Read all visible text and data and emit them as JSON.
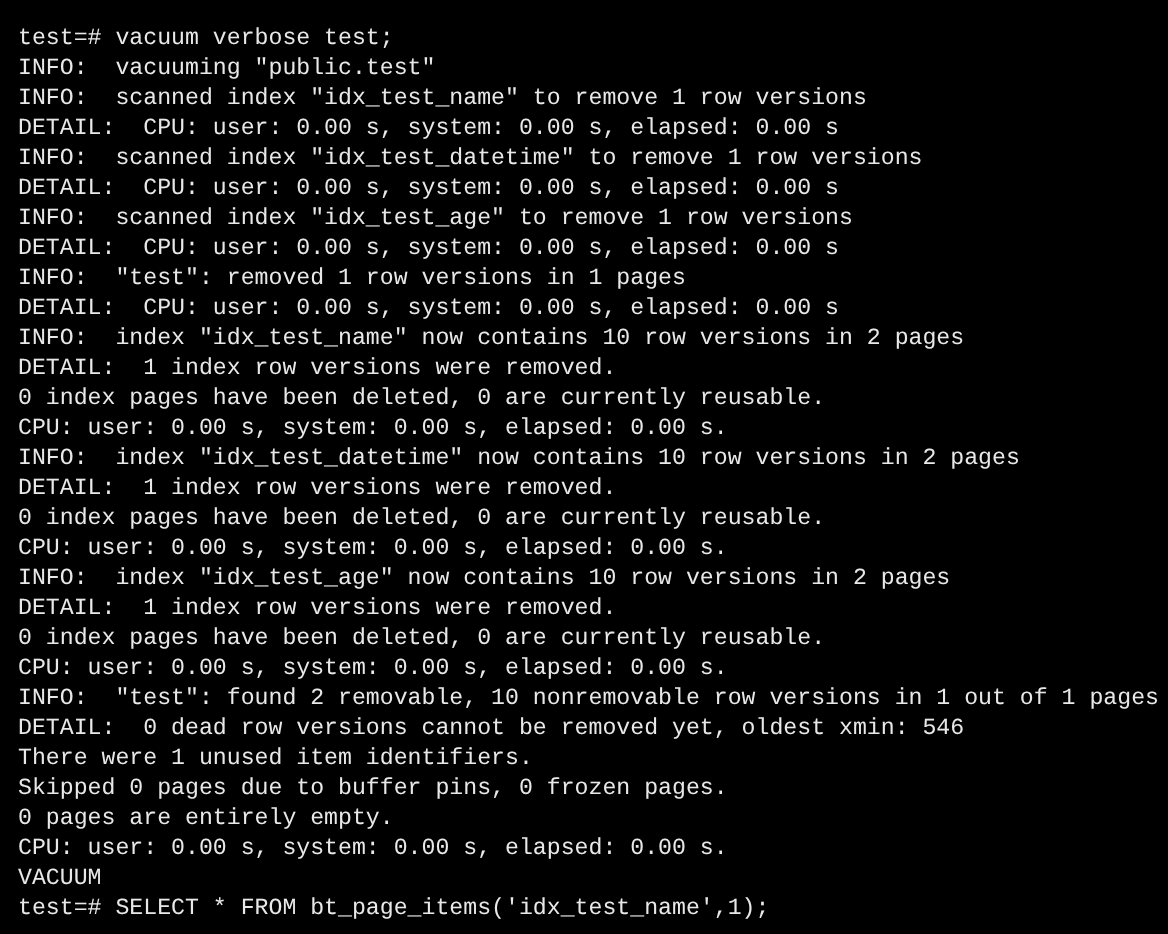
{
  "terminal": {
    "lines": [
      "test=# vacuum verbose test;",
      "INFO:  vacuuming \"public.test\"",
      "INFO:  scanned index \"idx_test_name\" to remove 1 row versions",
      "DETAIL:  CPU: user: 0.00 s, system: 0.00 s, elapsed: 0.00 s",
      "INFO:  scanned index \"idx_test_datetime\" to remove 1 row versions",
      "DETAIL:  CPU: user: 0.00 s, system: 0.00 s, elapsed: 0.00 s",
      "INFO:  scanned index \"idx_test_age\" to remove 1 row versions",
      "DETAIL:  CPU: user: 0.00 s, system: 0.00 s, elapsed: 0.00 s",
      "INFO:  \"test\": removed 1 row versions in 1 pages",
      "DETAIL:  CPU: user: 0.00 s, system: 0.00 s, elapsed: 0.00 s",
      "INFO:  index \"idx_test_name\" now contains 10 row versions in 2 pages",
      "DETAIL:  1 index row versions were removed.",
      "0 index pages have been deleted, 0 are currently reusable.",
      "CPU: user: 0.00 s, system: 0.00 s, elapsed: 0.00 s.",
      "INFO:  index \"idx_test_datetime\" now contains 10 row versions in 2 pages",
      "DETAIL:  1 index row versions were removed.",
      "0 index pages have been deleted, 0 are currently reusable.",
      "CPU: user: 0.00 s, system: 0.00 s, elapsed: 0.00 s.",
      "INFO:  index \"idx_test_age\" now contains 10 row versions in 2 pages",
      "DETAIL:  1 index row versions were removed.",
      "0 index pages have been deleted, 0 are currently reusable.",
      "CPU: user: 0.00 s, system: 0.00 s, elapsed: 0.00 s.",
      "INFO:  \"test\": found 2 removable, 10 nonremovable row versions in 1 out of 1 pages",
      "DETAIL:  0 dead row versions cannot be removed yet, oldest xmin: 546",
      "There were 1 unused item identifiers.",
      "Skipped 0 pages due to buffer pins, 0 frozen pages.",
      "0 pages are entirely empty.",
      "CPU: user: 0.00 s, system: 0.00 s, elapsed: 0.00 s.",
      "VACUUM",
      "test=# SELECT * FROM bt_page_items('idx_test_name',1);"
    ]
  }
}
